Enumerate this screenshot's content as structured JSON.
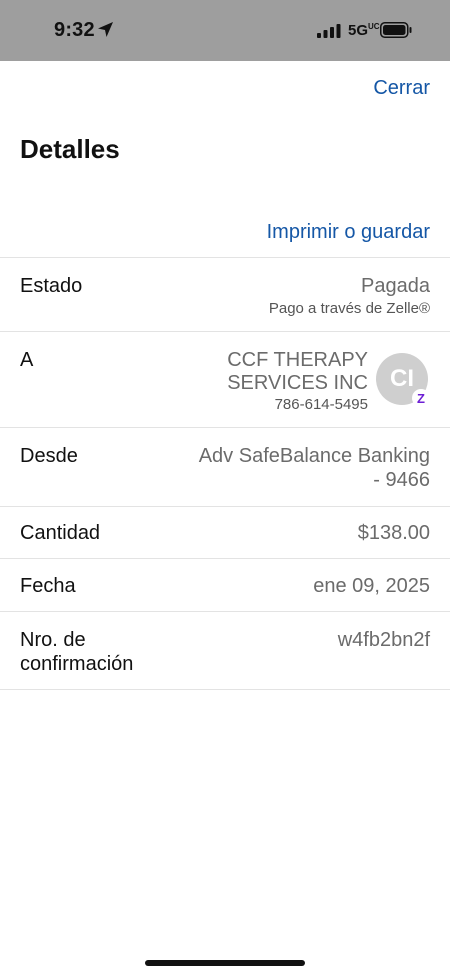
{
  "status_bar": {
    "time": "9:32",
    "network": "5G",
    "network_sup": "UC"
  },
  "header": {
    "close_label": "Cerrar"
  },
  "page_title": "Detalles",
  "print_label": "Imprimir o guardar",
  "details": {
    "estado": {
      "label": "Estado",
      "value": "Pagada",
      "sub": "Pago a través de Zelle®"
    },
    "a": {
      "label": "A",
      "name_line1": "CCF THERAPY",
      "name_line2": "SERVICES INC",
      "phone": "786-614-5495",
      "avatar_initials": "CI",
      "badge": "Z"
    },
    "desde": {
      "label": "Desde",
      "value_line1": "Adv SafeBalance Banking",
      "value_line2": "- 9466"
    },
    "cantidad": {
      "label": "Cantidad",
      "value": "$138.00"
    },
    "fecha": {
      "label": "Fecha",
      "value": "ene 09, 2025"
    },
    "confirmacion": {
      "label_line1": "Nro. de",
      "label_line2": "confirmación",
      "value": "w4fb2bn2f"
    }
  },
  "colors": {
    "link": "#1557a6",
    "status_bar": "#9e9e9e",
    "zelle": "#6d1ed4"
  }
}
